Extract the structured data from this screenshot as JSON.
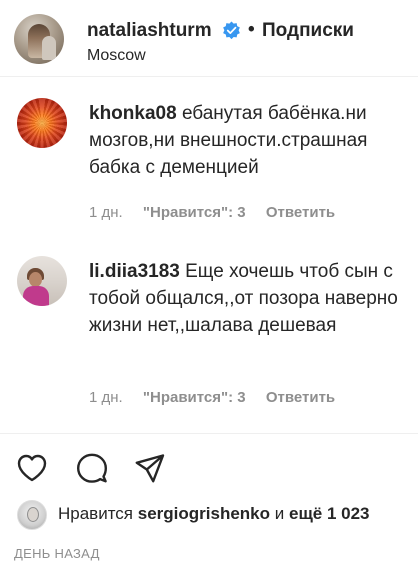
{
  "post_header": {
    "username": "nataliashturm",
    "verified_icon": "verified-badge-icon",
    "separator": "•",
    "follow_label": "Подписки",
    "location": "Moscow"
  },
  "comments": [
    {
      "username": "khonka08",
      "text": "ебанутая бабёнка.ни мозгов,ни внешности.страшная бабка с деменцией",
      "age": "1 дн.",
      "likes": "\"Нравится\": 3",
      "reply_label": "Ответить"
    },
    {
      "username": "li.diia3183",
      "text": "Еще хочешь чтоб сын с тобой общался,,от позора наверно жизни нет,,шалава дешевая",
      "age": "1 дн.",
      "likes": "\"Нравится\": 3",
      "reply_label": "Ответить"
    }
  ],
  "actions": {
    "like_icon": "heart-icon",
    "comment_icon": "comment-bubble-icon",
    "share_icon": "paper-plane-icon"
  },
  "likes_summary": {
    "prefix": "Нравится",
    "liker": "sergiogrishenko",
    "middle": "и",
    "rest": "ещё 1 023"
  },
  "timestamp": "ДЕНЬ НАЗАД"
}
